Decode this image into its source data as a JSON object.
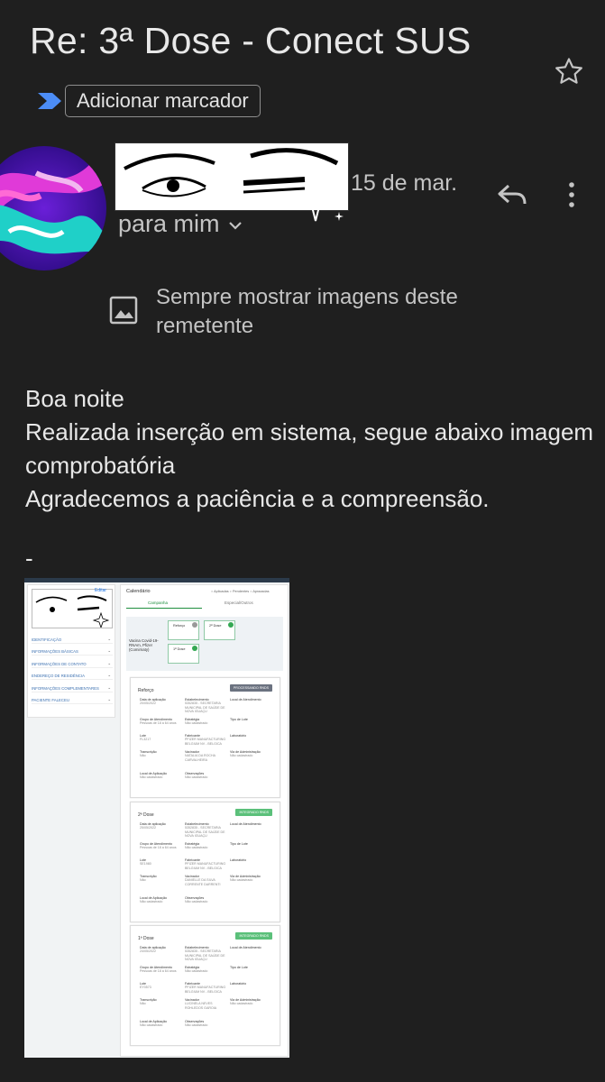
{
  "email": {
    "subject": "Re: 3ª Dose - Conect SUS",
    "label_button": "Adicionar marcador",
    "date": "15 de mar.",
    "recipient": "para mim",
    "show_images_text": "Sempre mostrar imagens deste remetente",
    "body": "Boa noite\nRealizada inserção em sistema, segue abaixo imagem comprobatória\nAgradecemos a paciência e a compreensão.",
    "signature_dash": "-"
  },
  "attachment": {
    "left_panel": {
      "edit": "Editar",
      "items": [
        "IDENTIFICAÇÃO",
        "INFORMAÇÕES BÁSICAS",
        "INFORMAÇÕES DE CONTATO",
        "ENDEREÇO DE RESIDÊNCIA",
        "INFORMAÇÕES COMPLEMENTARES",
        "PACIENTE FALECEU"
      ]
    },
    "calendar_title": "Calendário",
    "legend": "○ Aplicadas  ○ Pendentes  ○ Aprazadas",
    "tabs": [
      "Campanha",
      "Especial/Outros"
    ],
    "vaccine_name": "Vacina Covid-19-RNAm, Pfizer (Comirnaty)",
    "dose_boxes": [
      "Reforço",
      "2ª Dose",
      "1ª Dose"
    ],
    "cards": [
      {
        "title": "Reforço",
        "badge": "PROCESSANDO RNDS",
        "badge_color": "#6b7280",
        "fields": [
          [
            "Data de aplicação",
            "20/05/2022"
          ],
          [
            "Estabelecimento",
            "5352835 - SECRETARIA MUNICIPAL DE SAÚDE DE NOVA IGUAÇU"
          ],
          [
            "Local de Atendimento",
            ""
          ],
          [
            "Grupo de Atendimento",
            "Pessoas de 18 a 64 anos"
          ],
          [
            "Estratégia",
            "Não cadastrado"
          ],
          [
            "Tipo de Lote",
            ""
          ],
          [
            "Lote",
            "FL3217"
          ],
          [
            "Fabricante",
            "PFIZER MANUFACTURING BELGIUM NV - BELGICA"
          ],
          [
            "Laboratório",
            ""
          ],
          [
            "Transcrição",
            "Não"
          ],
          [
            "Vacinador",
            "NATALIA DA ROCHA CARVALHEIRA"
          ],
          [
            "Via de Administração",
            "Não cadastrado"
          ],
          [
            "Local de Aplicação",
            "Não cadastrado"
          ],
          [
            "Observações",
            "Não cadastrado"
          ],
          [
            "",
            ""
          ]
        ]
      },
      {
        "title": "2ª Dose",
        "badge": "INTEGRADO RNDS",
        "badge_color": "#5bc07a",
        "fields": [
          [
            "Data de aplicação",
            "25/05/2022"
          ],
          [
            "Estabelecimento",
            "5352835 - SECRETARIA MUNICIPAL DE SAÚDE DE NOVA IGUAÇU"
          ],
          [
            "Local de Atendimento",
            ""
          ],
          [
            "Grupo de Atendimento",
            "Pessoas de 18 a 64 anos"
          ],
          [
            "Estratégia",
            "Não cadastrado"
          ],
          [
            "Tipo de Lote",
            ""
          ],
          [
            "Lote",
            "SE1980"
          ],
          [
            "Fabricante",
            "PFIZER MANUFACTURING BELGIUM NV - BELGICA"
          ],
          [
            "Laboratório",
            ""
          ],
          [
            "Transcrição",
            "Não"
          ],
          [
            "Vacinador",
            "DANIELLE DA SILVA CORRENTE DARRENTI"
          ],
          [
            "Via de Administração",
            "Não cadastrado"
          ],
          [
            "Local de Aplicação",
            "Não cadastrado"
          ],
          [
            "Observações",
            "Não cadastrado"
          ],
          [
            "",
            ""
          ]
        ]
      },
      {
        "title": "1ª Dose",
        "badge": "INTEGRADO RNDS",
        "badge_color": "#5bc07a",
        "fields": [
          [
            "Data de aplicação",
            "24/05/2022"
          ],
          [
            "Estabelecimento",
            "5352835 - SECRETARIA MUNICIPAL DE SAÚDE DE NOVA IGUAÇU"
          ],
          [
            "Local de Atendimento",
            ""
          ],
          [
            "Grupo de Atendimento",
            "Pessoas de 18 a 64 anos"
          ],
          [
            "Estratégia",
            "Não cadastrado"
          ],
          [
            "Tipo de Lote",
            ""
          ],
          [
            "Lote",
            "EY0573"
          ],
          [
            "Fabricante",
            "PFIZER MANUFACTURING BELGIUM NV - BELGICA"
          ],
          [
            "Laboratório",
            ""
          ],
          [
            "Transcrição",
            "Não"
          ],
          [
            "Vacinador",
            "LUCINELA NEVES ROHLEDOS GAROIA"
          ],
          [
            "Via de Administração",
            "Não cadastrado"
          ],
          [
            "Local de Aplicação",
            "Não cadastrado"
          ],
          [
            "Observações",
            "Não cadastrado"
          ],
          [
            "",
            ""
          ]
        ]
      }
    ]
  },
  "colors": {
    "background": "#1f1f1f",
    "text": "#e3e3e3",
    "muted": "#c4c4c4",
    "label_chevron": "#1a73e8"
  },
  "icons": [
    "star-icon",
    "label-chevron-icon",
    "reply-icon",
    "more-vert-icon",
    "chevron-down-icon",
    "image-icon",
    "sparkle-icon"
  ]
}
